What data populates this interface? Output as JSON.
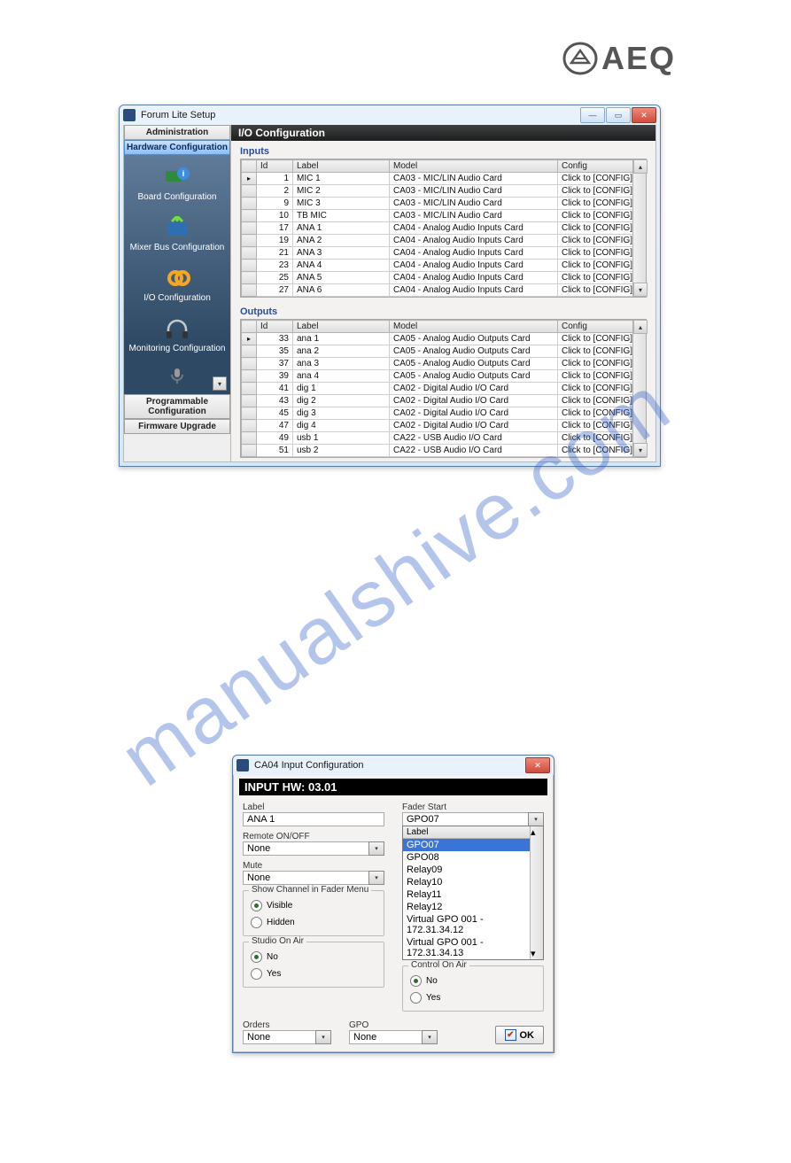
{
  "logo": "AEQ",
  "watermark_text": "manualshive.com",
  "window1": {
    "title": "Forum Lite Setup",
    "sidebar": {
      "tab_admin": "Administration",
      "tab_hw": "Hardware Configuration",
      "items": [
        {
          "label": "Board Configuration"
        },
        {
          "label": "Mixer Bus Configuration"
        },
        {
          "label": "I/O Configuration"
        },
        {
          "label": "Monitoring Configuration"
        }
      ],
      "tab_prog": "Programmable Configuration",
      "tab_fw": "Firmware Upgrade"
    },
    "header": "I/O Configuration",
    "inputs_title": "Inputs",
    "outputs_title": "Outputs",
    "cols": {
      "id": "Id",
      "label": "Label",
      "model": "Model",
      "config": "Config"
    },
    "inputs": [
      {
        "id": "1",
        "label": "MIC 1",
        "model": "CA03 - MIC/LIN Audio Card",
        "cfg": "Click to [CONFIG]"
      },
      {
        "id": "2",
        "label": "MIC 2",
        "model": "CA03 - MIC/LIN Audio Card",
        "cfg": "Click to [CONFIG]"
      },
      {
        "id": "9",
        "label": "MIC 3",
        "model": "CA03 - MIC/LIN Audio Card",
        "cfg": "Click to [CONFIG]"
      },
      {
        "id": "10",
        "label": "TB MIC",
        "model": "CA03 - MIC/LIN Audio Card",
        "cfg": "Click to [CONFIG]"
      },
      {
        "id": "17",
        "label": "ANA 1",
        "model": "CA04 - Analog Audio Inputs Card",
        "cfg": "Click to [CONFIG]"
      },
      {
        "id": "19",
        "label": "ANA 2",
        "model": "CA04 - Analog Audio Inputs Card",
        "cfg": "Click to [CONFIG]"
      },
      {
        "id": "21",
        "label": "ANA 3",
        "model": "CA04 - Analog Audio Inputs Card",
        "cfg": "Click to [CONFIG]"
      },
      {
        "id": "23",
        "label": "ANA 4",
        "model": "CA04 - Analog Audio Inputs Card",
        "cfg": "Click to [CONFIG]"
      },
      {
        "id": "25",
        "label": "ANA 5",
        "model": "CA04 - Analog Audio Inputs Card",
        "cfg": "Click to [CONFIG]"
      },
      {
        "id": "27",
        "label": "ANA 6",
        "model": "CA04 - Analog Audio Inputs Card",
        "cfg": "Click to [CONFIG]"
      }
    ],
    "outputs": [
      {
        "id": "33",
        "label": "ana 1",
        "model": "CA05 - Analog Audio Outputs Card",
        "cfg": "Click to [CONFIG]"
      },
      {
        "id": "35",
        "label": "ana 2",
        "model": "CA05 - Analog Audio Outputs Card",
        "cfg": "Click to [CONFIG]"
      },
      {
        "id": "37",
        "label": "ana 3",
        "model": "CA05 - Analog Audio Outputs Card",
        "cfg": "Click to [CONFIG]"
      },
      {
        "id": "39",
        "label": "ana 4",
        "model": "CA05 - Analog Audio Outputs Card",
        "cfg": "Click to [CONFIG]"
      },
      {
        "id": "41",
        "label": "dig 1",
        "model": "CA02 - Digital Audio I/O Card",
        "cfg": "Click to [CONFIG]"
      },
      {
        "id": "43",
        "label": "dig 2",
        "model": "CA02 - Digital Audio I/O Card",
        "cfg": "Click to [CONFIG]"
      },
      {
        "id": "45",
        "label": "dig 3",
        "model": "CA02 - Digital Audio I/O Card",
        "cfg": "Click to [CONFIG]"
      },
      {
        "id": "47",
        "label": "dig 4",
        "model": "CA02 - Digital Audio I/O Card",
        "cfg": "Click to [CONFIG]"
      },
      {
        "id": "49",
        "label": "usb 1",
        "model": "CA22 - USB Audio I/O Card",
        "cfg": "Click to [CONFIG]"
      },
      {
        "id": "51",
        "label": "usb 2",
        "model": "CA22 - USB Audio I/O Card",
        "cfg": "Click to [CONFIG]"
      }
    ]
  },
  "window2": {
    "title": "CA04 Input Configuration",
    "hw": "INPUT HW: 03.01",
    "label_label": "Label",
    "label_value": "ANA 1",
    "remote_label": "Remote ON/OFF",
    "remote_value": "None",
    "mute_label": "Mute",
    "mute_value": "None",
    "fader_start_label": "Fader Start",
    "fader_start_value": "GPO07",
    "dropdown": {
      "header": "Label",
      "items": [
        "GPO07",
        "GPO08",
        "Relay09",
        "Relay10",
        "Relay11",
        "Relay12",
        "Virtual GPO 001 - 172.31.34.12",
        "Virtual GPO 001 - 172.31.34.13"
      ]
    },
    "group_show": {
      "title": "Show Channel in Fader Menu",
      "opt1": "Visible",
      "opt2": "Hidden"
    },
    "group_studio": {
      "title": "Studio On Air",
      "opt1": "No",
      "opt2": "Yes"
    },
    "group_control": {
      "title": "Control On Air",
      "opt1": "No",
      "opt2": "Yes"
    },
    "orders_label": "Orders",
    "orders_value": "None",
    "gpo_label": "GPO",
    "gpo_value": "None",
    "ok_label": "OK"
  }
}
